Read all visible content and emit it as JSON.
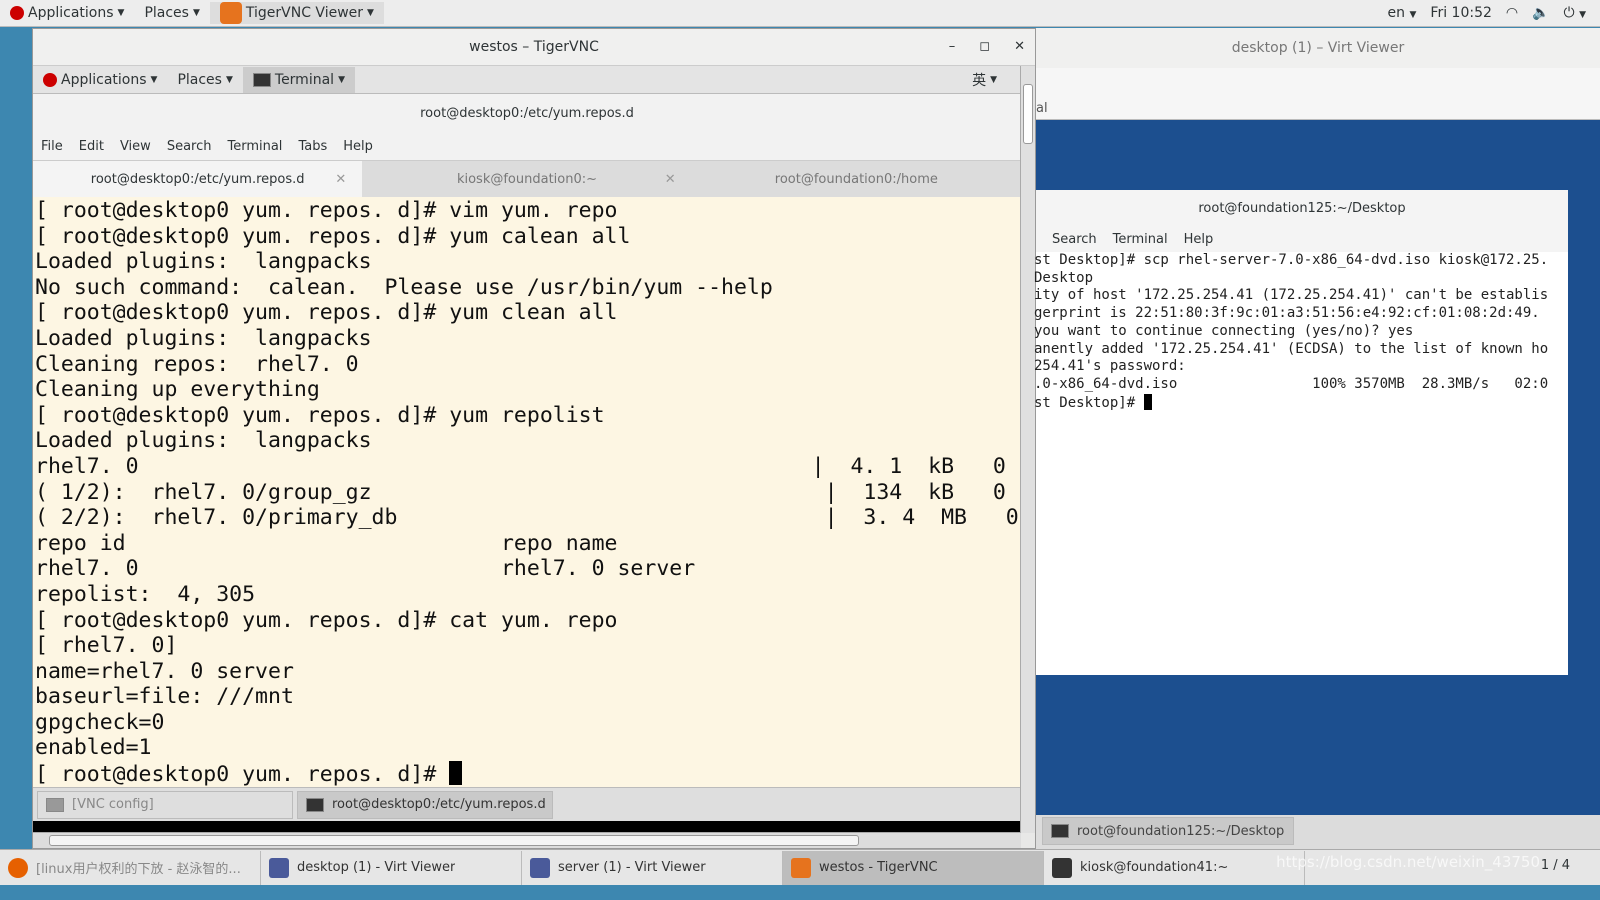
{
  "topbar": {
    "applications": "Applications",
    "places": "Places",
    "app": "TigerVNC Viewer",
    "lang": "en",
    "clock": "Fri 10:52"
  },
  "vnc": {
    "title": "westos – TigerVNC",
    "inner": {
      "applications": "Applications",
      "places": "Places",
      "terminal": "Terminal",
      "ime": "英"
    },
    "terminal": {
      "title": "root@desktop0:/etc/yum.repos.d",
      "menu": [
        "File",
        "Edit",
        "View",
        "Search",
        "Terminal",
        "Tabs",
        "Help"
      ],
      "tabs": [
        {
          "label": "root@desktop0:/etc/yum.repos.d",
          "active": true
        },
        {
          "label": "kiosk@foundation0:~",
          "active": false
        },
        {
          "label": "root@foundation0:/home",
          "active": false
        }
      ],
      "lines": [
        "[ root@desktop0 yum. repos. d]# vim yum. repo",
        "[ root@desktop0 yum. repos. d]# yum calean all",
        "Loaded plugins:  langpacks",
        "No such command:  calean.  Please use /usr/bin/yum --help",
        "[ root@desktop0 yum. repos. d]# yum clean all",
        "Loaded plugins:  langpacks",
        "Cleaning repos:  rhel7. 0",
        "Cleaning up everything",
        "[ root@desktop0 yum. repos. d]# yum repolist",
        "Loaded plugins:  langpacks",
        "rhel7. 0                                                    |  4. 1  kB   0",
        "( 1/2):  rhel7. 0/group_gz                                   |  134  kB   0",
        "( 2/2):  rhel7. 0/primary_db                                 |  3. 4  MB   0",
        "repo id                             repo name",
        "rhel7. 0                            rhel7. 0 server",
        "repolist:  4, 305",
        "[ root@desktop0 yum. repos. d]# cat yum. repo",
        "[ rhel7. 0]",
        "name=rhel7. 0 server",
        "baseurl=file: ///mnt",
        "gpgcheck=0",
        "enabled=1"
      ],
      "prompt": "[ root@desktop0 yum. repos. d]# "
    },
    "tasks": [
      "[VNC config]",
      "root@desktop0:/etc/yum.repos.d"
    ]
  },
  "virt": {
    "title": "desktop (1) – Virt Viewer",
    "strip": "al",
    "terminal": {
      "title": "root@foundation125:~/Desktop",
      "menu": [
        "Search",
        "Terminal",
        "Help"
      ],
      "lines": [
        "st Desktop]# scp rhel-server-7.0-x86_64-dvd.iso kiosk@172.25.",
        "Desktop",
        "ity of host '172.25.254.41 (172.25.254.41)' can't be establis",
        "gerprint is 22:51:80:3f:9c:01:a3:51:56:e4:92:cf:01:08:2d:49.",
        "you want to continue connecting (yes/no)? yes",
        "anently added '172.25.254.41' (ECDSA) to the list of known ho",
        "254.41's password:",
        ".0-x86_64-dvd.iso                100% 3570MB  28.3MB/s   02:0"
      ],
      "prompt": "st Desktop]# "
    },
    "task": "root@foundation125:~/Desktop"
  },
  "taskbar": {
    "items": [
      "[linux用户权利的下放 - 赵泳智的...",
      "desktop (1) - Virt Viewer",
      "server (1) - Virt Viewer",
      "westos - TigerVNC",
      "kiosk@foundation41:~"
    ],
    "pager": "1 / 4",
    "watermark": "https://blog.csdn.net/weixin_43750"
  }
}
